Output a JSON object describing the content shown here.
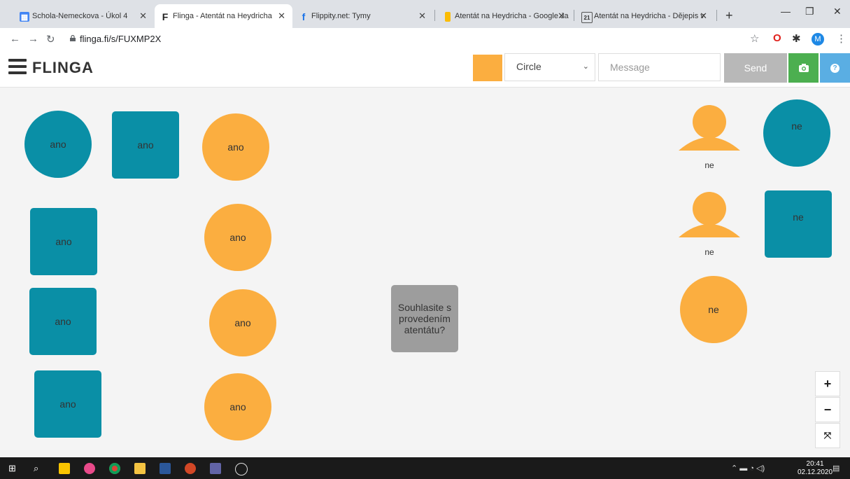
{
  "browser": {
    "tabs": [
      {
        "title": "Schola-Nemeckova - Úkol 4",
        "active": false,
        "favicon_color": "#4285f4"
      },
      {
        "title": "Flinga - Atentát na Heydricha",
        "active": true,
        "favicon_color": "#222222"
      },
      {
        "title": "Flippity.net: Tymy",
        "active": false,
        "favicon_color": "#1a73e8"
      },
      {
        "title": "Atentát na Heydricha - Google Ja",
        "active": false,
        "favicon_color": "#fbbc04"
      },
      {
        "title": "Atentát na Heydricha - Dějepis v",
        "active": false,
        "favicon_color": "#555555"
      }
    ],
    "url": "flinga.fi/s/FUXMP2X",
    "profile_initial": "M"
  },
  "app": {
    "logo": "FLINGA",
    "shape_select": "Circle",
    "message_placeholder": "Message",
    "send_label": "Send",
    "accent_color": "#fbae40",
    "teal_color": "#0a8fa6"
  },
  "board": {
    "items": [
      {
        "type": "circle",
        "color": "teal",
        "text": "ano"
      },
      {
        "type": "square",
        "color": "teal",
        "text": "ano"
      },
      {
        "type": "circle",
        "color": "orange",
        "text": "ano"
      },
      {
        "type": "square",
        "color": "teal",
        "text": "ano"
      },
      {
        "type": "circle",
        "color": "orange",
        "text": "ano"
      },
      {
        "type": "square",
        "color": "teal",
        "text": "ano"
      },
      {
        "type": "circle",
        "color": "orange",
        "text": "ano"
      },
      {
        "type": "square",
        "color": "teal",
        "text": "ano"
      },
      {
        "type": "circle",
        "color": "orange",
        "text": "ano"
      },
      {
        "type": "question",
        "color": "gray",
        "text": "Souhlasite s provedením atentátu?"
      },
      {
        "type": "person",
        "color": "orange",
        "text": "ne"
      },
      {
        "type": "circle",
        "color": "teal",
        "text": "ne"
      },
      {
        "type": "person",
        "color": "orange",
        "text": "ne"
      },
      {
        "type": "square",
        "color": "teal",
        "text": "ne"
      },
      {
        "type": "circle",
        "color": "orange",
        "text": "ne"
      }
    ]
  },
  "taskbar": {
    "time": "20:41",
    "date": "02.12.2020"
  }
}
